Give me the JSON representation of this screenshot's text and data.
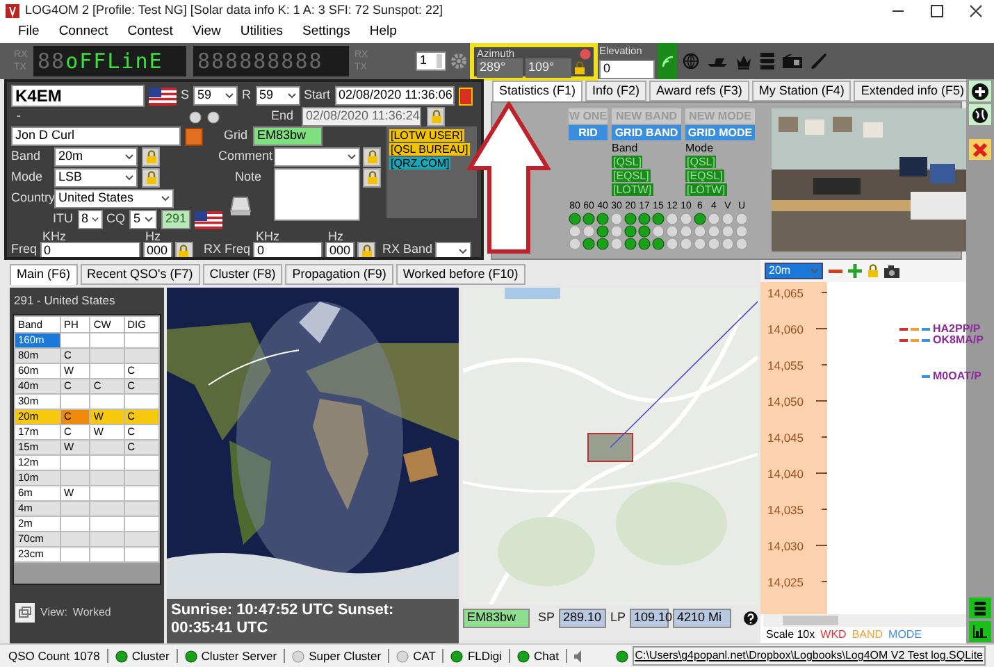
{
  "window": {
    "title": "LOG4OM 2 [Profile: Test NG] [Solar data info K: 1 A: 3 SFI: 72 Sunspot: 22]"
  },
  "menu": [
    "File",
    "Connect",
    "Contest",
    "View",
    "Utilities",
    "Settings",
    "Help"
  ],
  "radio_display": {
    "rx_label": "RX",
    "tx_label": "TX",
    "segments": [
      {
        "text": "88",
        "lit": false
      },
      {
        "text": "oFFLinE",
        "lit": true
      }
    ],
    "segments_2": [
      {
        "text": "888888888",
        "lit": false
      }
    ],
    "rx_label_2": "RX",
    "tx_label_2": "TX",
    "radio_number": "1"
  },
  "rotator": {
    "title": "Azimuth",
    "short_path": "289°",
    "long_path": "109°",
    "highlighted": true,
    "elevation_label": "Elevation",
    "elevation": "0"
  },
  "qso": {
    "callsign": "K4EM",
    "rst_sent_label": "S",
    "rst_sent": "59",
    "rst_rcvd_label": "R",
    "rst_rcvd": "59",
    "start_label": "Start",
    "start": "02/08/2020 11:36:06",
    "end_label": "End",
    "end": "02/08/2020 11:36:24",
    "dash": "-",
    "name": "Jon D Curl",
    "grid_label": "Grid",
    "grid": "EM83bw",
    "band_label": "Band",
    "band": "20m",
    "mode_label": "Mode",
    "mode": "LSB",
    "country_label": "Country",
    "country": "United States",
    "itu_label": "ITU",
    "itu": "8",
    "cq_label": "CQ",
    "cq": "5",
    "dxcc": "291",
    "comment_label": "Comment",
    "note_label": "Note",
    "freq_label": "Freq",
    "freq_unit": "KHz",
    "freq": "0",
    "freq_hz_unit": "Hz",
    "freq_hz": "000",
    "rx_freq_label": "RX Freq",
    "rx_freq_unit": "KHz",
    "rx_freq": "0",
    "rx_freq_hz_unit": "Hz",
    "rx_freq_hz": "000",
    "rx_band_label": "RX Band"
  },
  "badges": [
    {
      "text": "[LOTW USER]",
      "color": "#f2c200"
    },
    {
      "text": "[QSL BUREAU]",
      "color": "#f2c200"
    },
    {
      "text": "[QRZ.COM]",
      "color": "#19a7b8"
    }
  ],
  "info_tabs": [
    {
      "label": "Statistics (F1)",
      "selected": true
    },
    {
      "label": "Info (F2)",
      "selected": false
    },
    {
      "label": "Award refs (F3)",
      "selected": false
    },
    {
      "label": "My Station (F4)",
      "selected": false
    },
    {
      "label": "Extended info (F5)",
      "selected": false
    }
  ],
  "statistics": {
    "columns": [
      {
        "new": "W ONE",
        "new_active": false,
        "grid": "RID",
        "grid_active": true
      },
      {
        "new": "NEW BAND",
        "new_active": false,
        "grid": "GRID BAND",
        "grid_active": true,
        "heading": "Band",
        "tags": [
          "[QSL]",
          "[EQSL]",
          "[LOTW]"
        ]
      },
      {
        "new": "NEW MODE",
        "new_active": false,
        "grid": "GRID MODE",
        "grid_active": true,
        "heading": "Mode",
        "tags": [
          "[QSL]",
          "[EQSL]",
          "[LOTW]"
        ]
      }
    ],
    "band_labels": [
      "80",
      "60",
      "40",
      "30",
      "20",
      "17",
      "15",
      "12",
      "10",
      "6",
      "4",
      "V",
      "U"
    ],
    "led_rows": [
      [
        true,
        true,
        true,
        false,
        true,
        true,
        true,
        false,
        false,
        true,
        false,
        false,
        false
      ],
      [
        false,
        false,
        true,
        false,
        true,
        true,
        false,
        false,
        false,
        false,
        false,
        false,
        false
      ],
      [
        false,
        true,
        true,
        false,
        true,
        true,
        true,
        false,
        false,
        false,
        false,
        false,
        false
      ]
    ]
  },
  "lower_tabs": [
    {
      "label": "Main (F6)",
      "selected": true
    },
    {
      "label": "Recent QSO's (F7)",
      "selected": false
    },
    {
      "label": "Cluster (F8)",
      "selected": false
    },
    {
      "label": "Propagation (F9)",
      "selected": false
    },
    {
      "label": "Worked before (F10)",
      "selected": false
    }
  ],
  "worked": {
    "title": "291 - United States",
    "columns": [
      "Band",
      "PH",
      "CW",
      "DIG"
    ],
    "rows": [
      {
        "band": "160m",
        "ph": "",
        "cw": "",
        "dig": "",
        "selected": true,
        "highlighted": false
      },
      {
        "band": "80m",
        "ph": "C",
        "cw": "",
        "dig": "",
        "selected": false,
        "highlighted": false
      },
      {
        "band": "60m",
        "ph": "W",
        "cw": "",
        "dig": "C",
        "selected": false,
        "highlighted": false
      },
      {
        "band": "40m",
        "ph": "C",
        "cw": "C",
        "dig": "C",
        "selected": false,
        "highlighted": false
      },
      {
        "band": "30m",
        "ph": "",
        "cw": "",
        "dig": "",
        "selected": false,
        "highlighted": false
      },
      {
        "band": "20m",
        "ph": "C",
        "cw": "W",
        "dig": "C",
        "selected": false,
        "highlighted": true
      },
      {
        "band": "17m",
        "ph": "C",
        "cw": "W",
        "dig": "C",
        "selected": false,
        "highlighted": false
      },
      {
        "band": "15m",
        "ph": "W",
        "cw": "",
        "dig": "C",
        "selected": false,
        "highlighted": false
      },
      {
        "band": "12m",
        "ph": "",
        "cw": "",
        "dig": "",
        "selected": false,
        "highlighted": false
      },
      {
        "band": "10m",
        "ph": "",
        "cw": "",
        "dig": "",
        "selected": false,
        "highlighted": false
      },
      {
        "band": "6m",
        "ph": "W",
        "cw": "",
        "dig": "",
        "selected": false,
        "highlighted": false
      },
      {
        "band": "4m",
        "ph": "",
        "cw": "",
        "dig": "",
        "selected": false,
        "highlighted": false
      },
      {
        "band": "2m",
        "ph": "",
        "cw": "",
        "dig": "",
        "selected": false,
        "highlighted": false
      },
      {
        "band": "70cm",
        "ph": "",
        "cw": "",
        "dig": "",
        "selected": false,
        "highlighted": false
      },
      {
        "band": "23cm",
        "ph": "",
        "cw": "",
        "dig": "",
        "selected": false,
        "highlighted": false
      }
    ],
    "view_label": "View:",
    "view": "Worked"
  },
  "sun": {
    "text": "Sunrise: 10:47:52 UTC  Sunset: 00:35:41 UTC"
  },
  "map_footer": {
    "grid": "EM83bw",
    "sp_label": "SP",
    "sp": "289.10",
    "lp_label": "LP",
    "lp": "109.10",
    "distance": "4210 Mi"
  },
  "bandmap": {
    "band": "20m",
    "ticks": [
      "14,065",
      "14,060",
      "14,055",
      "14,050",
      "14,045",
      "14,040",
      "14,035",
      "14,030",
      "14,025"
    ],
    "spots": [
      {
        "call": "HA2PP/P",
        "wkd": true,
        "band_new": true,
        "mode_new": true
      },
      {
        "call": "OK8MA/P",
        "wkd": true,
        "band_new": true,
        "mode_new": true
      },
      {
        "call": "M0OAT/P",
        "wkd": false,
        "band_new": false,
        "mode_new": true
      }
    ],
    "scale": "Scale 10x",
    "legend": [
      {
        "text": "WKD",
        "color": "#e03030"
      },
      {
        "text": "BAND",
        "color": "#f0a030"
      },
      {
        "text": "MODE",
        "color": "#4090e0"
      }
    ]
  },
  "status_bar": {
    "qso_count_label": "QSO Count",
    "qso_count": "1078",
    "services": [
      {
        "name": "Cluster",
        "on": true
      },
      {
        "name": "Cluster Server",
        "on": true
      },
      {
        "name": "Super Cluster",
        "on": false
      },
      {
        "name": "CAT",
        "on": false
      },
      {
        "name": "FLDigi",
        "on": true
      },
      {
        "name": "Chat",
        "on": true
      }
    ],
    "database": "C:\\Users\\g4popanl.net\\Dropbox\\Logbooks\\Log4OM V2 Test log.SQLite",
    "database_on": true
  }
}
